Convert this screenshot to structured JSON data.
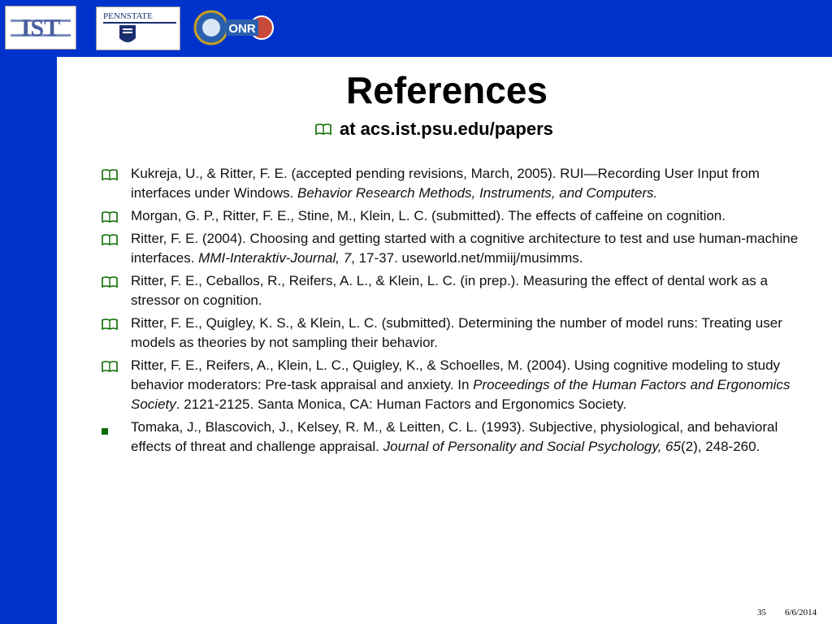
{
  "header": {
    "logo_ist_text": "IST",
    "logo_psu_text": "PENNSTATE",
    "logo_onr_text": "ONR"
  },
  "slide": {
    "title": "References",
    "subtitle": "at acs.ist.psu.edu/papers"
  },
  "refs": [
    {
      "pre": "Kukreja, U., & Ritter, F. E. (accepted pending revisions, March, 2005).  RUI—Recording User Input from interfaces under Windows.  ",
      "italic": "Behavior Research Methods, Instruments, and Computers.",
      "post": "",
      "bullet": "book"
    },
    {
      "pre": "Morgan, G. P., Ritter, F. E., Stine, M., Klein, L. C. (submitted).  The effects of caffeine on cognition.",
      "italic": "",
      "post": "",
      "bullet": "book"
    },
    {
      "pre": "Ritter, F. E. (2004). Choosing and getting started with a cognitive architecture to test and use human-machine interfaces. ",
      "italic": "MMI-Interaktiv-Journal, 7",
      "post": ", 17-37.  useworld.net/mmiij/musimms.",
      "bullet": "book"
    },
    {
      "pre": "Ritter, F. E., Ceballos, R., Reifers, A. L., & Klein, L. C. (in prep.).  Measuring the effect of dental work as a stressor on cognition.",
      "italic": "",
      "post": "",
      "bullet": "book"
    },
    {
      "pre": "Ritter, F. E., Quigley, K. S., & Klein, L. C. (submitted).  Determining the number of model runs: Treating user models as theories by not sampling their behavior.",
      "italic": "",
      "post": "",
      "bullet": "book"
    },
    {
      "pre": "Ritter, F. E., Reifers, A., Klein, L. C., Quigley, K., & Schoelles, M. (2004). Using cognitive modeling to study behavior moderators: Pre-task appraisal and anxiety. In ",
      "italic": "Proceedings of the Human Factors and Ergonomics Society",
      "post": ".  2121-2125.  Santa Monica, CA: Human Factors and Ergonomics Society.",
      "bullet": "book"
    },
    {
      "pre": "Tomaka, J., Blascovich, J., Kelsey, R. M., & Leitten, C. L. (1993). Subjective, physiological, and behavioral effects of threat and challenge appraisal. ",
      "italic": "Journal of Personality and Social Psychology, 65",
      "post": "(2), 248-260.",
      "bullet": "square"
    }
  ],
  "footer": {
    "page_number": "35",
    "date": "6/6/2014"
  },
  "colors": {
    "bar": "#0033cc",
    "book_icon": "#0b6b00"
  }
}
